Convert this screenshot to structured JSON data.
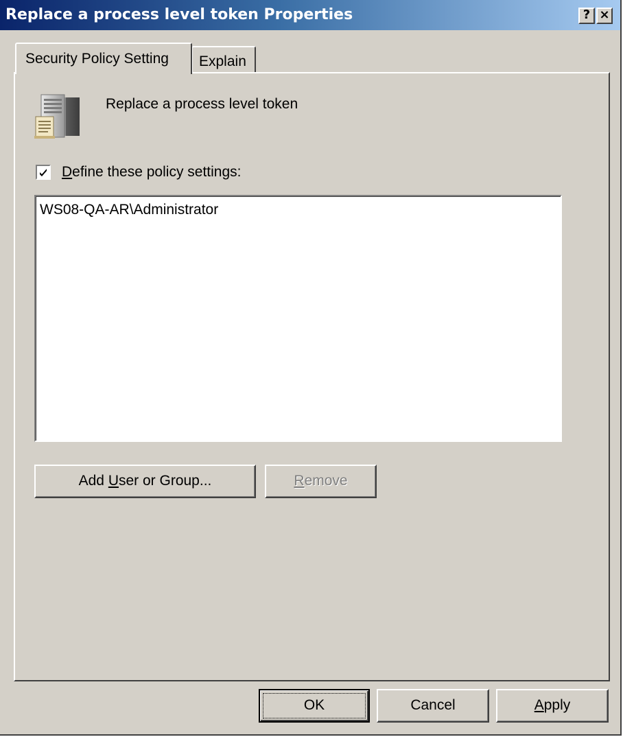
{
  "window": {
    "title": "Replace a process level token Properties",
    "help_label": "?",
    "close_label": "×"
  },
  "tabs": [
    {
      "label": "Security Policy Setting",
      "active": true
    },
    {
      "label": "Explain",
      "active": false
    }
  ],
  "policy": {
    "icon": "server-policy-icon",
    "name": "Replace a process level token"
  },
  "define_checkbox": {
    "checked": true,
    "label_accel": "D",
    "label_rest": "efine these policy settings:"
  },
  "members": {
    "items": [
      "WS08-QA-AR\\Administrator"
    ]
  },
  "buttons": {
    "add_prefix": "Add ",
    "add_accel": "U",
    "add_rest": "ser or Group...",
    "remove_accel": "R",
    "remove_rest": "emove",
    "ok": "OK",
    "cancel": "Cancel",
    "apply_accel": "A",
    "apply_rest": "pply"
  }
}
